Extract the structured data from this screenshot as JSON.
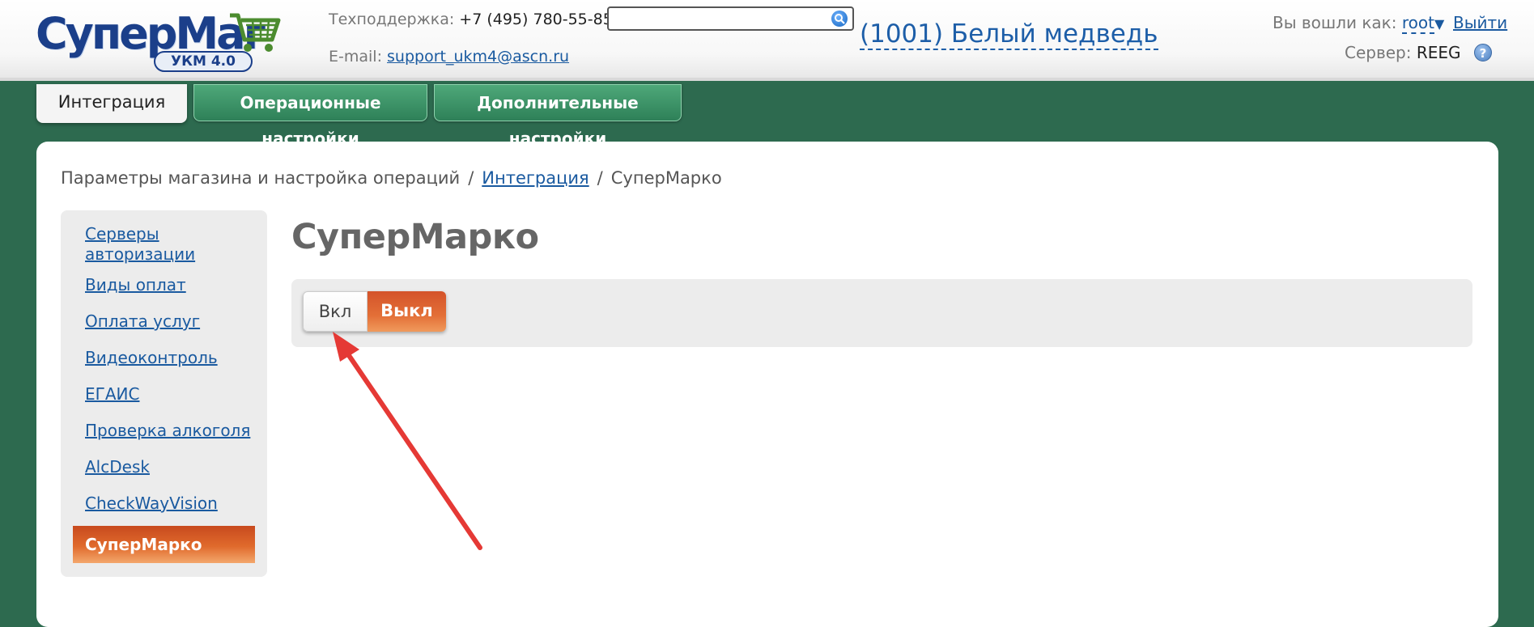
{
  "header": {
    "logo_text": "СуперМаг",
    "logo_badge": "УКМ 4.0",
    "support_label": "Техподдержка:",
    "support_phone": "+7 (495) 780-55-85",
    "email_label": "E-mail:",
    "email": "support_ukm4@ascn.ru",
    "search_value": "",
    "store_name": "(1001) Белый медведь",
    "logged_in_label": "Вы вошли как:",
    "user_name": "root",
    "logout": "Выйти",
    "server_label": "Сервер:",
    "server_name": "REEG",
    "help": "?"
  },
  "tabs": [
    {
      "label": "Интеграция",
      "active": true
    },
    {
      "label": "Операционные настройки",
      "active": false
    },
    {
      "label": "Дополнительные настройки",
      "active": false
    }
  ],
  "breadcrumb": {
    "root": "Параметры магазина и настройка операций",
    "link": "Интеграция",
    "current": "СуперМарко"
  },
  "sidebar": {
    "items": [
      {
        "label": "Серверы авторизации"
      },
      {
        "label": "Виды оплат"
      },
      {
        "label": "Оплата услуг"
      },
      {
        "label": "Видеоконтроль"
      },
      {
        "label": "ЕГАИС"
      },
      {
        "label": "Проверка алкоголя"
      },
      {
        "label": "AlcDesk"
      },
      {
        "label": "CheckWayVision"
      }
    ],
    "active": "СуперМарко"
  },
  "main": {
    "title": "СуперМарко",
    "toggle_on": "Вкл",
    "toggle_off": "Выкл",
    "toggle_state": "off"
  },
  "colors": {
    "background": "#2d6a4f",
    "accent_orange": "#e06a2c",
    "link_blue": "#1a5aa0",
    "tab_green": "#3a9468",
    "annotation_red": "#e53935"
  }
}
